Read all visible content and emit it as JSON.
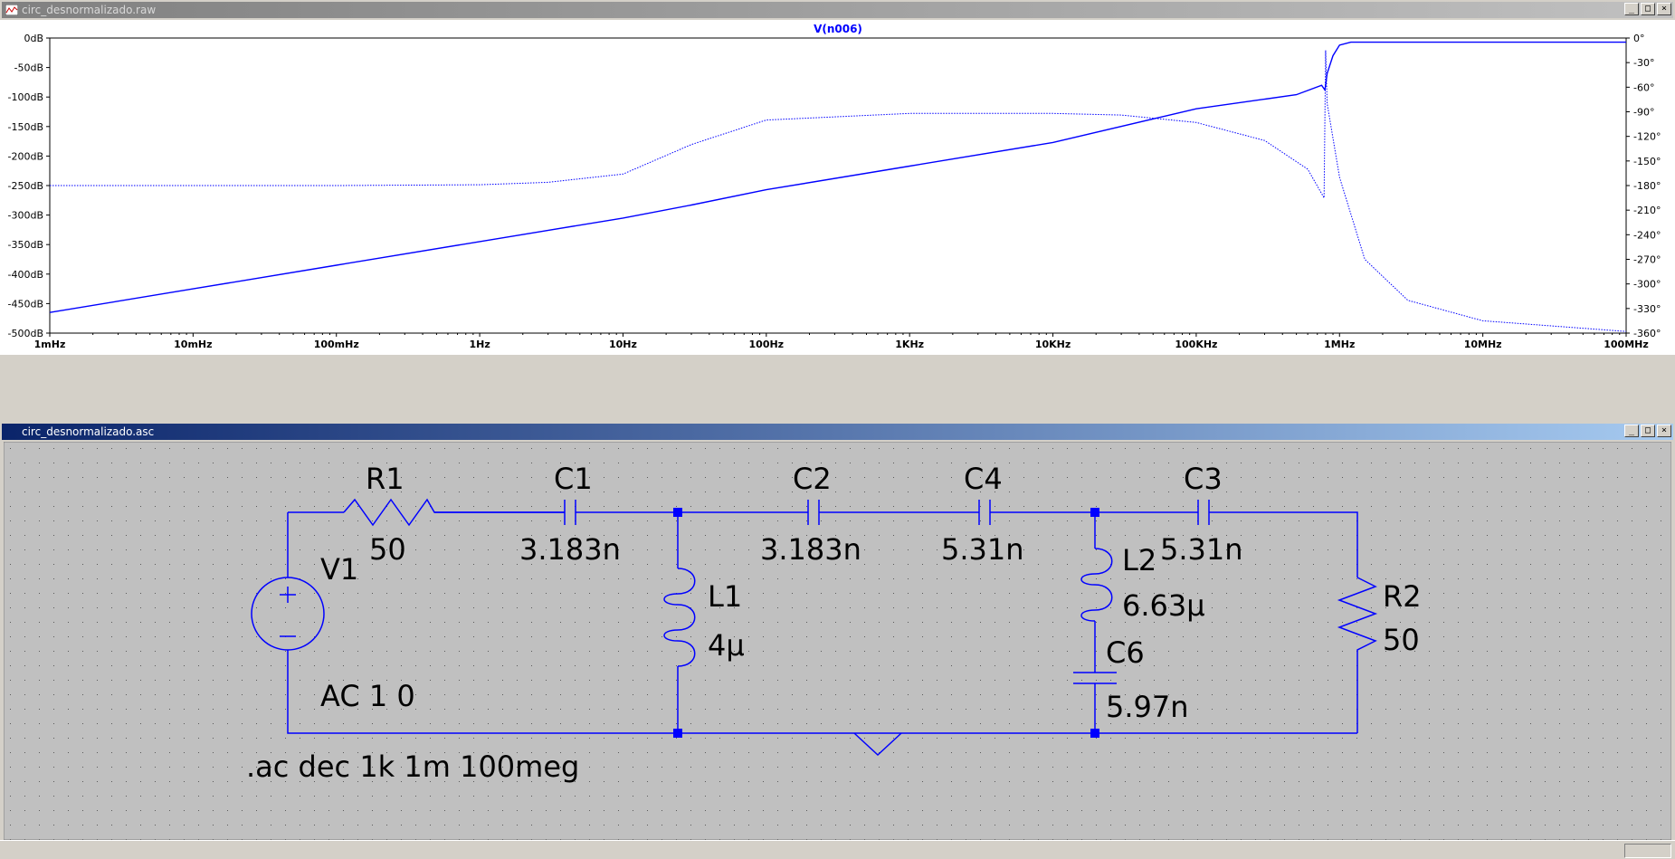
{
  "waveform_window": {
    "title": "circ_desnormalizado.raw",
    "trace_label": "V(n006)",
    "trace_color": "#0000ff",
    "y_left_ticks": [
      "0dB",
      "-50dB",
      "-100dB",
      "-150dB",
      "-200dB",
      "-250dB",
      "-300dB",
      "-350dB",
      "-400dB",
      "-450dB",
      "-500dB"
    ],
    "y_right_ticks": [
      "0°",
      "-30°",
      "-60°",
      "-90°",
      "-120°",
      "-150°",
      "-180°",
      "-210°",
      "-240°",
      "-270°",
      "-300°",
      "-330°",
      "-360°"
    ],
    "x_ticks": [
      "1mHz",
      "10mHz",
      "100mHz",
      "1Hz",
      "10Hz",
      "100Hz",
      "1KHz",
      "10KHz",
      "100KHz",
      "1MHz",
      "10MHz",
      "100MHz"
    ]
  },
  "chart_data": {
    "type": "line",
    "x_scale": "log",
    "xlim": [
      0.001,
      100000000
    ],
    "ylim_left": [
      -500,
      0
    ],
    "ylim_right": [
      -360,
      0
    ],
    "series": [
      {
        "name": "V(n006)",
        "axis": "left",
        "style": "solid",
        "x": [
          0.001,
          0.01,
          0.1,
          1,
          10,
          30,
          100,
          1000,
          10000,
          100000,
          500000,
          750000,
          790000,
          800000,
          820000,
          900000,
          1000000,
          1200000,
          10000000,
          100000000
        ],
        "y": [
          -465,
          -425,
          -385,
          -345,
          -305,
          -283,
          -257,
          -217,
          -177,
          -120,
          -96,
          -80,
          -88,
          -80,
          -60,
          -30,
          -12,
          -7,
          -7,
          -7
        ]
      },
      {
        "name": "phase",
        "axis": "right",
        "style": "dotted",
        "x": [
          0.001,
          0.1,
          1,
          3,
          10,
          30,
          100,
          1000,
          10000,
          30000,
          100000,
          300000,
          600000,
          780000,
          800000,
          820000,
          1000000,
          1500000,
          3000000,
          10000000,
          100000000
        ],
        "y": [
          -180,
          -180,
          -179,
          -176,
          -166,
          -130,
          -100,
          -92,
          -92,
          -94,
          -103,
          -125,
          -160,
          -195,
          -15,
          -80,
          -170,
          -270,
          -320,
          -345,
          -358
        ]
      }
    ]
  },
  "schematic_window": {
    "title": "circ_desnormalizado.asc",
    "components": {
      "r1_name": "R1",
      "r1_value": "50",
      "c1_name": "C1",
      "c1_value": "3.183n",
      "c2_name": "C2",
      "c2_value": "3.183n",
      "c4_name": "C4",
      "c4_value": "5.31n",
      "c3_name": "C3",
      "c3_value": "5.31n",
      "v1_name": "V1",
      "v1_value": "AC 1 0",
      "l1_name": "L1",
      "l1_value": "4µ",
      "l2_name": "L2",
      "l2_value": "6.63µ",
      "c6_name": "C6",
      "c6_value": "5.97n",
      "r2_name": "R2",
      "r2_value": "50"
    },
    "directive": ".ac dec 1k 1m 100meg",
    "wire_color": "#0000ff",
    "text_color": "#000000"
  },
  "window_buttons": {
    "minimize": "_",
    "restore": "□",
    "close": "×"
  }
}
